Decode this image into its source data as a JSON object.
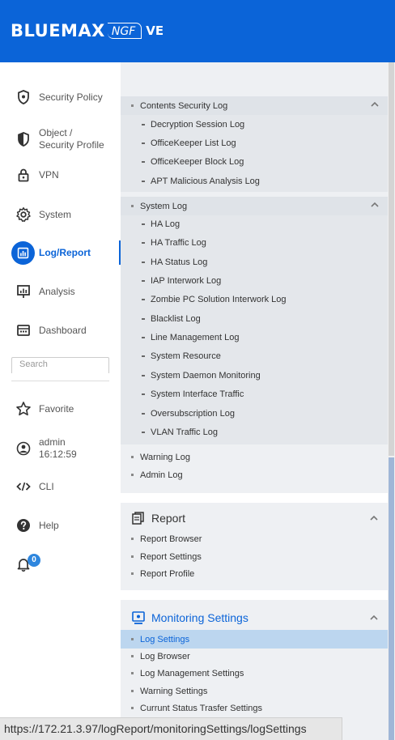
{
  "app": {
    "brand_main": "BLUEMAX",
    "brand_ngf": "NGF",
    "brand_ve": "VE"
  },
  "sidebar": {
    "items": [
      {
        "label": "Security Policy",
        "icon": "shield-icon"
      },
      {
        "label": "Object /\nSecurity Profile",
        "icon": "shield-half-icon"
      },
      {
        "label": "VPN",
        "icon": "lock-icon"
      },
      {
        "label": "System",
        "icon": "gear-icon"
      },
      {
        "label": "Log/Report",
        "icon": "chart-icon",
        "active": true
      },
      {
        "label": "Analysis",
        "icon": "analysis-icon"
      },
      {
        "label": "Dashboard",
        "icon": "dashboard-icon"
      }
    ],
    "search_placeholder": "Search",
    "favorite_label": "Favorite",
    "admin_user": "admin",
    "admin_time": "16:12:59",
    "cli_label": "CLI",
    "help_label": "Help",
    "notification_count": "0",
    "accent_color": "#0b64d8"
  },
  "main": {
    "contents_security": {
      "label": "Contents Security Log",
      "children": [
        "Decryption Session Log",
        "OfficeKeeper List Log",
        "OfficeKeeper Block Log",
        "APT Malicious Analysis Log"
      ]
    },
    "system_log": {
      "label": "System Log",
      "children": [
        "HA Log",
        "HA Traffic Log",
        "HA Status Log",
        "IAP Interwork Log",
        "Zombie PC Solution Interwork Log",
        "Blacklist Log",
        "Line Management Log",
        "System Resource",
        "System Daemon Monitoring",
        "System Interface Traffic",
        "Oversubscription Log",
        "VLAN Traffic Log"
      ]
    },
    "warning_log": "Warning Log",
    "admin_log": "Admin Log",
    "report": {
      "title": "Report",
      "items": [
        "Report Browser",
        "Report Settings",
        "Report Profile"
      ]
    },
    "monitoring": {
      "title": "Monitoring Settings",
      "items": [
        "Log Settings",
        "Log Browser",
        "Log Management Settings",
        "Warning Settings",
        "Currunt Status Trasfer Settings"
      ],
      "selected": "Log Settings"
    }
  },
  "status_url": "https://172.21.3.97/logReport/monitoringSettings/logSettings"
}
